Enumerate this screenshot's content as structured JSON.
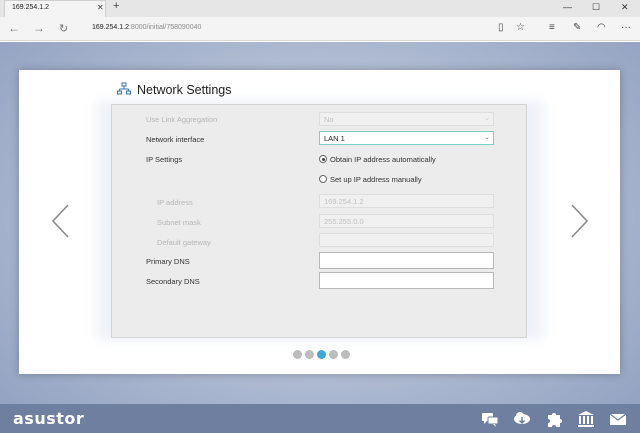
{
  "browser": {
    "tab_title": "169.254.1.2",
    "tab_close": "✕",
    "new_tab": "+",
    "url_host": "169.254.1.2",
    "url_rest": ":8000/initial/758090040"
  },
  "page": {
    "title": "Network Settings",
    "icon": "network-icon"
  },
  "form": {
    "link_aggregation_label": "Use Link Aggregation",
    "link_aggregation_value": "No",
    "network_interface_label": "Network interface",
    "network_interface_value": "LAN 1",
    "ip_settings_label": "IP Settings",
    "ip_auto_label": "Obtain IP address automatically",
    "ip_manual_label": "Set up IP address manually",
    "ip_mode_selected": "auto",
    "ip_address_label": "IP address",
    "ip_address_value": "169.254.1.2",
    "subnet_mask_label": "Subnet mask",
    "subnet_mask_value": "255.255.0.0",
    "default_gateway_label": "Default gateway",
    "default_gateway_value": "",
    "primary_dns_label": "Primary DNS",
    "primary_dns_value": "",
    "secondary_dns_label": "Secondary DNS",
    "secondary_dns_value": ""
  },
  "pagination": {
    "total": 5,
    "active_index": 2
  },
  "footer": {
    "brand": "asustor",
    "icons": [
      "chat-icon",
      "cloud-download-icon",
      "puzzle-icon",
      "bank-icon",
      "mail-icon"
    ]
  },
  "colors": {
    "accent": "#3fa9d6",
    "footer_bg": "#6f7f9f",
    "active_border": "#7ad1c8"
  }
}
